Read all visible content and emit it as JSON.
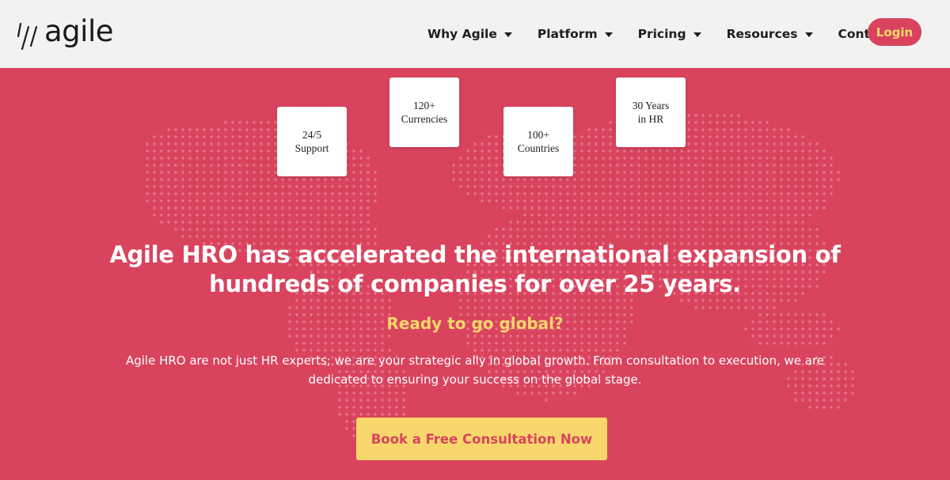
{
  "brand": {
    "logo_text": "agile"
  },
  "nav": {
    "items": [
      {
        "label": "Why Agile",
        "has_dropdown": true
      },
      {
        "label": "Platform",
        "has_dropdown": true
      },
      {
        "label": "Pricing",
        "has_dropdown": true
      },
      {
        "label": "Resources",
        "has_dropdown": true
      },
      {
        "label": "Contact",
        "has_dropdown": false
      }
    ],
    "login_label": "Login"
  },
  "hero": {
    "stats": [
      {
        "label": "24/5\nSupport"
      },
      {
        "label": "120+\nCurrencies"
      },
      {
        "label": "100+\nCountries"
      },
      {
        "label": "30 Years\nin HR"
      }
    ],
    "headline": "Agile HRO has accelerated the international expansion of hundreds of companies for over 25 years.",
    "subheadline": "Ready to go global?",
    "description": "Agile HRO are not just HR experts; we are your strategic ally in global growth. From consultation to execution, we are dedicated to ensuring your success on the global stage.",
    "cta_label": "Book a Free Consultation Now"
  },
  "colors": {
    "accent": "#d9435d",
    "highlight": "#f7d76b",
    "header_bg": "#f3f2f2"
  },
  "icons": {
    "logo_mark": "slash-logo-icon",
    "dropdown": "caret-down-icon",
    "background": "dotted-world-map"
  }
}
